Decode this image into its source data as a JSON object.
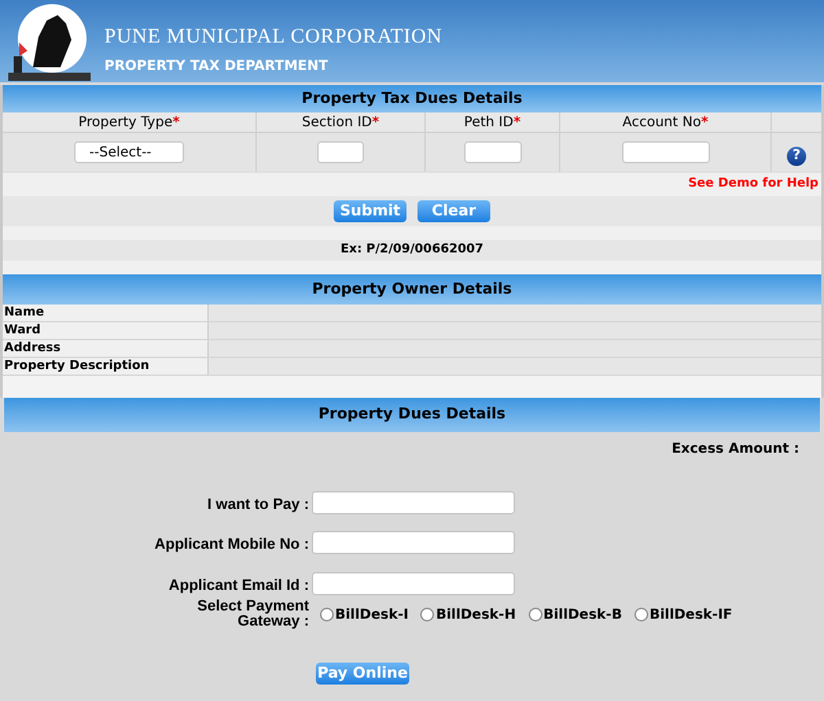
{
  "header": {
    "title": "PUNE MUNICIPAL CORPORATION",
    "subtitle": "PROPERTY TAX DEPARTMENT"
  },
  "dues_search": {
    "title": "Property Tax Dues Details",
    "columns": [
      {
        "label": "Property Type",
        "marker": "*",
        "kind": "select",
        "value": "--Select--"
      },
      {
        "label": "Section ID",
        "marker": "*",
        "kind": "input"
      },
      {
        "label": "Peth ID",
        "marker": "*",
        "kind": "input"
      },
      {
        "label": "Account No",
        "marker": "*",
        "kind": "input"
      }
    ],
    "help_icon": "?",
    "help_link": "See Demo for Help",
    "buttons": [
      "Submit",
      "Clear"
    ],
    "example": "Ex: P/2/09/00662007"
  },
  "owner": {
    "title": "Property Owner Details",
    "rows": [
      {
        "label": "Name"
      },
      {
        "label": "Ward"
      },
      {
        "label": "Address"
      },
      {
        "label": "Property Description"
      }
    ]
  },
  "dues": {
    "title": "Property Dues Details",
    "excess_label": "Excess Amount :",
    "fields": [
      {
        "label": "I want to Pay :"
      },
      {
        "label": "Applicant Mobile No :"
      },
      {
        "label": "Applicant Email Id :"
      }
    ],
    "gateway": {
      "label": "Select Payment Gateway :",
      "options": [
        {
          "label": "BillDesk-I",
          "selected": false
        },
        {
          "label": "BillDesk-H",
          "selected": false
        },
        {
          "label": "BillDesk-B",
          "selected": false
        },
        {
          "label": "BillDesk-IF",
          "selected": false
        }
      ]
    },
    "pay_button": "Pay Online"
  }
}
